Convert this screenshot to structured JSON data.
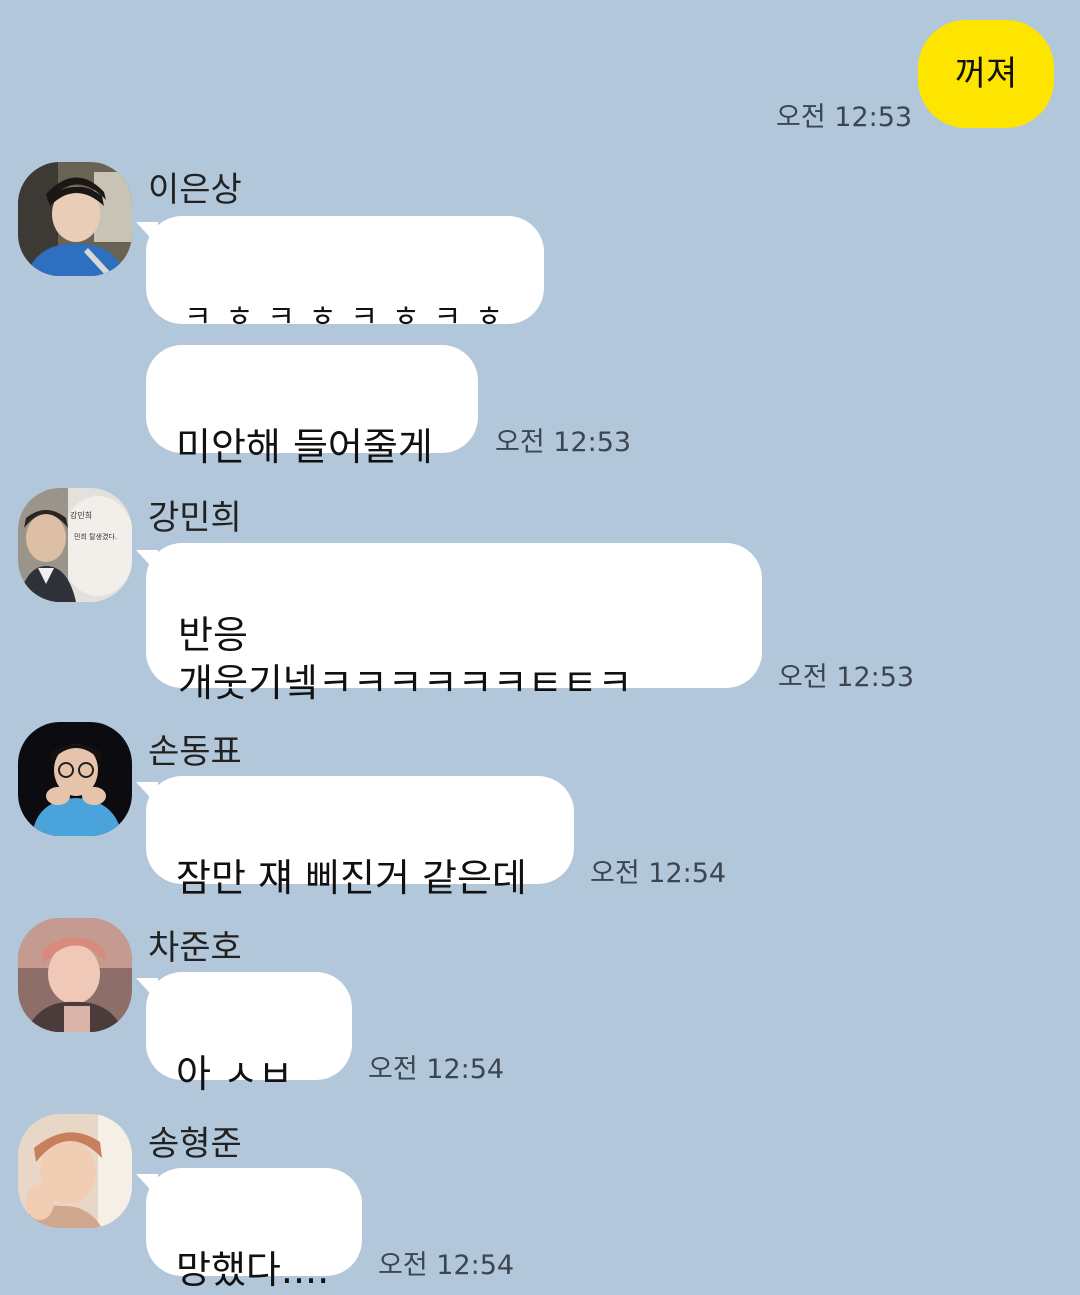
{
  "my_message": {
    "text": "꺼져",
    "time": "오전 12:53",
    "color": "#fee500"
  },
  "messages": [
    {
      "sender": "이은상",
      "avatar_icon": "profile-photo-icon",
      "bubbles": [
        "ㅋㅎㅋㅎㅋㅎㅋㅎ",
        "미안해 들어줄게"
      ],
      "time": "오전 12:53"
    },
    {
      "sender": "강민희",
      "avatar_icon": "profile-photo-icon",
      "avatar_caption_1": "강민희",
      "avatar_caption_2": "민희 탈생겼다.",
      "bubbles": [
        "반응\n개웃기넼ㅋㅋㅋㅋㅋㅋㅌㅌㅋ"
      ],
      "time": "오전 12:53"
    },
    {
      "sender": "손동표",
      "avatar_icon": "profile-photo-icon",
      "bubbles": [
        "잠만 쟤 삐진거 같은데"
      ],
      "time": "오전 12:54"
    },
    {
      "sender": "차준호",
      "avatar_icon": "profile-photo-icon",
      "bubbles": [
        "아 ㅅㅂ"
      ],
      "time": "오전 12:54"
    },
    {
      "sender": "송형준",
      "avatar_icon": "profile-photo-icon",
      "bubbles": [
        "망했다...."
      ],
      "time": "오전 12:54"
    }
  ],
  "colors": {
    "background": "#b2c7da",
    "bubble": "#ffffff",
    "timestamp": "#3c4650"
  }
}
